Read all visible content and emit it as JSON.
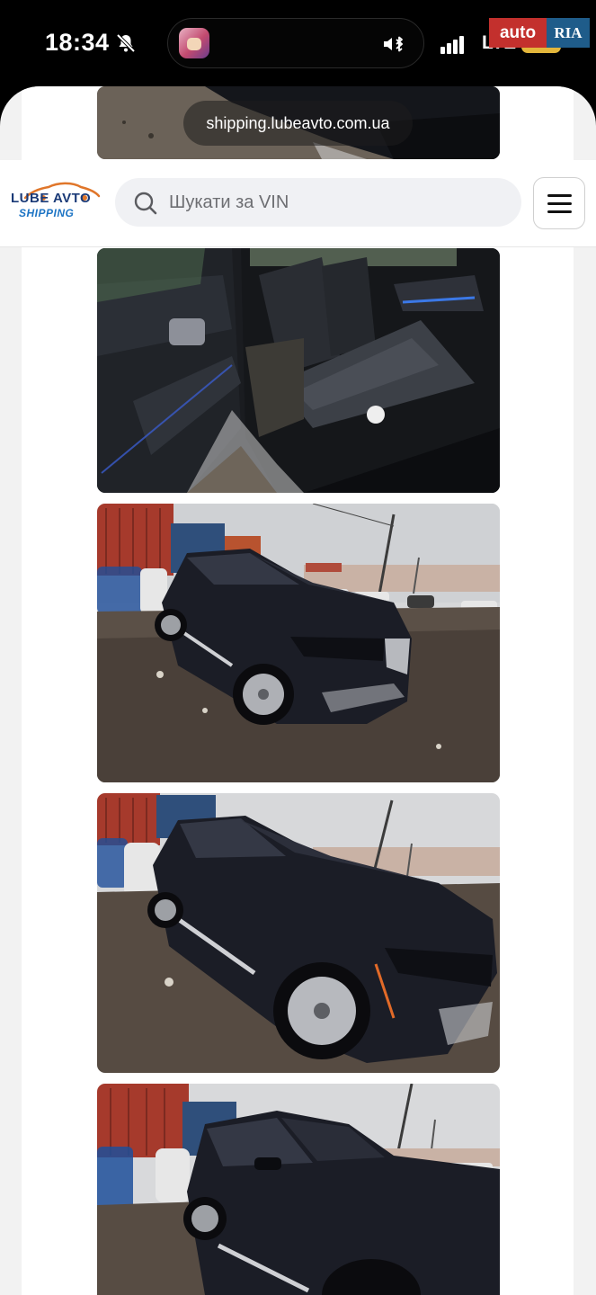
{
  "status_bar": {
    "time": "18:34",
    "network": "LTE",
    "battery": "14"
  },
  "watermark": {
    "part1": "auto",
    "part2": "RIA"
  },
  "browser": {
    "url": "shipping.lubeavto.com.ua"
  },
  "site": {
    "logo": {
      "line1": "LUBE AVTO",
      "line2": "SHIPPING"
    },
    "search": {
      "placeholder": "Шукати за VIN"
    }
  },
  "gallery": {
    "photos": [
      "bmw-x5-door-sill-partial",
      "bmw-x5-rear-seat-interior",
      "bmw-x5-front-three-quarter",
      "bmw-x5-front-side-closeup",
      "bmw-x5-side-partial"
    ]
  }
}
